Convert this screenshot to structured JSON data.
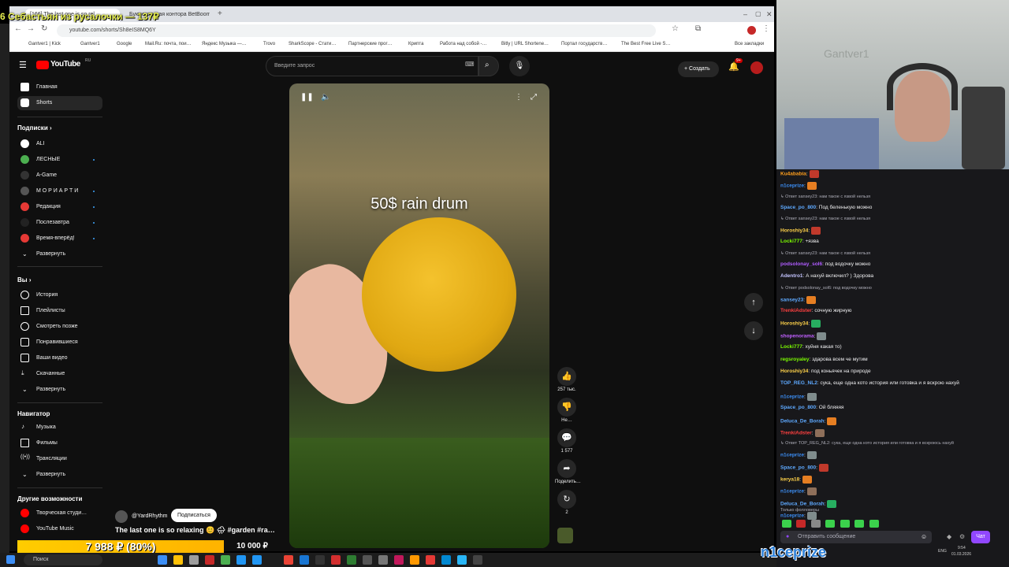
{
  "browser": {
    "tabs": [
      "[166] The last one is so rel…",
      "Букмекерская контора BetBoom…"
    ],
    "url": "youtube.com/shorts/Sh8eIS8MQ6Y",
    "bookmarks": [
      "Gantver1 | Kick",
      "Gantver1",
      "Google",
      "Mail.Ru: почта, пои…",
      "Яндекс Музыка —…",
      "Trovo",
      "SharkScope - Стати…",
      "Партнерские прог…",
      "Крипта",
      "Работа над собой -…",
      "Bitly | URL Shortene…",
      "Портал государств…",
      "The Best Free Live S…",
      "Все закладки"
    ]
  },
  "youtube": {
    "logo": "YouTube",
    "logo_region": "RU",
    "search_placeholder": "Введите запрос",
    "create_label": "Создать",
    "notif_count": "9+",
    "sidebar": {
      "main": [
        {
          "label": "Главная",
          "icon": "home-icon"
        },
        {
          "label": "Shorts",
          "icon": "shorts-icon",
          "active": true
        }
      ],
      "subs_title": "Подписки",
      "subs": [
        {
          "label": "ALI",
          "color": "#ffffff"
        },
        {
          "label": "ЛЕСНЫЕ",
          "color": "#4caf50"
        },
        {
          "label": "A-Game",
          "color": "#222222"
        },
        {
          "label": "М О Р И А Р Т И",
          "color": "#444444"
        },
        {
          "label": "Редакция",
          "color": "#e53935"
        },
        {
          "label": "Послезавтра",
          "color": "#111111"
        },
        {
          "label": "Время-вперёд!",
          "color": "#e53935"
        }
      ],
      "expand": "Развернуть",
      "you_title": "Вы",
      "you": [
        {
          "label": "История",
          "icon": "history-icon"
        },
        {
          "label": "Плейлисты",
          "icon": "playlist-icon"
        },
        {
          "label": "Смотреть позже",
          "icon": "clock-icon"
        },
        {
          "label": "Понравившиеся",
          "icon": "like-icon"
        },
        {
          "label": "Ваши видео",
          "icon": "video-icon"
        },
        {
          "label": "Скачанные",
          "icon": "download-icon"
        }
      ],
      "nav_title": "Навигатор",
      "nav": [
        {
          "label": "Музыка",
          "icon": "music-icon"
        },
        {
          "label": "Фильмы",
          "icon": "film-icon"
        },
        {
          "label": "Трансляции",
          "icon": "live-icon"
        }
      ],
      "more_title": "Другие возможности",
      "more": [
        {
          "label": "Творческая студи…",
          "icon": "studio-icon"
        },
        {
          "label": "YouTube Music",
          "icon": "ytmusic-icon"
        }
      ]
    },
    "short": {
      "overlay_title": "50$ rain drum",
      "channel": "@YardRhythm",
      "subscribe": "Подписаться",
      "title": "The last one is so relaxing 😊 🌧 #garden #ra…",
      "likes": "257 тыс.",
      "dislike": "Не…",
      "comments": "1 577",
      "share": "Поделить…",
      "remix": "2"
    }
  },
  "stream": {
    "sub_banner": "6 Себастьян из русалочки — 137₽",
    "donation": "7 988 ₽ (80%)",
    "donation_goal": "10 000 ₽",
    "donation_progress": 0.8,
    "nick": "n1ceprize",
    "cam_text": "Gantver1",
    "chat_filter": "Только фолловеры",
    "chat_placeholder": "Отправить сообщение",
    "chat_button": "Чат",
    "clock": "9:54",
    "date": "01.03.2026",
    "lang": "ENG",
    "taskbar_search": "Поиск",
    "chat": [
      {
        "type": "msg",
        "user": "Ku4ababia",
        "color": "#ff9f1c",
        "text": ":"
      },
      {
        "type": "msg",
        "user": "n1ceprize",
        "color": "#3c8ef5",
        "text": ":"
      },
      {
        "type": "reply",
        "text": "Ответ sansey23: нам такое с язвой нельзя"
      },
      {
        "type": "msg",
        "user": "Space_po_800",
        "color": "#5ea9ff",
        "text": ": Под беленькую можно"
      },
      {
        "type": "reply",
        "text": "Ответ sansey23: нам такое с язвой нельзя"
      },
      {
        "type": "msg",
        "user": "Horoshiy34",
        "color": "#ffd24a",
        "text": ":"
      },
      {
        "type": "msg",
        "user": "Locki777",
        "color": "#7cfc00",
        "text": ": +язва"
      },
      {
        "type": "reply",
        "text": "Ответ sansey23: нам такое с язвой нельзя"
      },
      {
        "type": "msg",
        "user": "podsolonay_sol6",
        "color": "#b05cff",
        "text": ": под водочку можно"
      },
      {
        "type": "msg",
        "user": "Adentro1",
        "color": "#c4c4ff",
        "text": ": А нахуй включил? ) Здорова"
      },
      {
        "type": "reply",
        "text": "Ответ podsolonay_sol6: под водочку можно"
      },
      {
        "type": "msg",
        "user": "sansey23",
        "color": "#5ea9ff",
        "text": ":"
      },
      {
        "type": "msg",
        "user": "TrenkiAdster",
        "color": "#ff4040",
        "text": ": сочную жирную"
      },
      {
        "type": "msg",
        "user": "Horoshiy34",
        "color": "#ffd24a",
        "text": ":"
      },
      {
        "type": "msg",
        "user": "shopenorama",
        "color": "#c060ff",
        "text": ":"
      },
      {
        "type": "msg",
        "user": "Locki777",
        "color": "#7cfc00",
        "text": ": хуйня какая то)"
      },
      {
        "type": "msg",
        "user": "regsroyaley",
        "color": "#7cfc00",
        "text": ": здарова всем че мутим"
      },
      {
        "type": "msg",
        "user": "Horoshiy34",
        "color": "#ffd24a",
        "text": ": под коньячек на природе"
      },
      {
        "type": "msg",
        "user": "TOP_REG_NL2",
        "color": "#5ea9ff",
        "text": ": сука, еще одна кото история или готовка и я вскрою нахуй"
      },
      {
        "type": "msg",
        "user": "n1ceprize",
        "color": "#3c8ef5",
        "text": ":"
      },
      {
        "type": "msg",
        "user": "Space_po_800",
        "color": "#5ea9ff",
        "text": ": Ой бляяяя"
      },
      {
        "type": "msg",
        "user": "Deluca_De_Borah",
        "color": "#5ea9ff",
        "text": ":"
      },
      {
        "type": "msg",
        "user": "TrenkiAdster",
        "color": "#ff4040",
        "text": ":"
      },
      {
        "type": "reply",
        "text": "Ответ TOP_REG_NL2: сука, еще одна кото история или готовка и я вскроюсь нахуй"
      },
      {
        "type": "msg",
        "user": "n1ceprize",
        "color": "#3c8ef5",
        "text": ":"
      },
      {
        "type": "msg",
        "user": "Space_po_800",
        "color": "#5ea9ff",
        "text": ":"
      },
      {
        "type": "msg",
        "user": "kerya18",
        "color": "#ffd24a",
        "text": ":"
      },
      {
        "type": "msg",
        "user": "n1ceprize",
        "color": "#3c8ef5",
        "text": ":"
      },
      {
        "type": "msg",
        "user": "Deluca_De_Borah",
        "color": "#5ea9ff",
        "text": ":"
      },
      {
        "type": "msg",
        "user": "n1ceprize",
        "color": "#3c8ef5",
        "text": ":"
      }
    ]
  }
}
